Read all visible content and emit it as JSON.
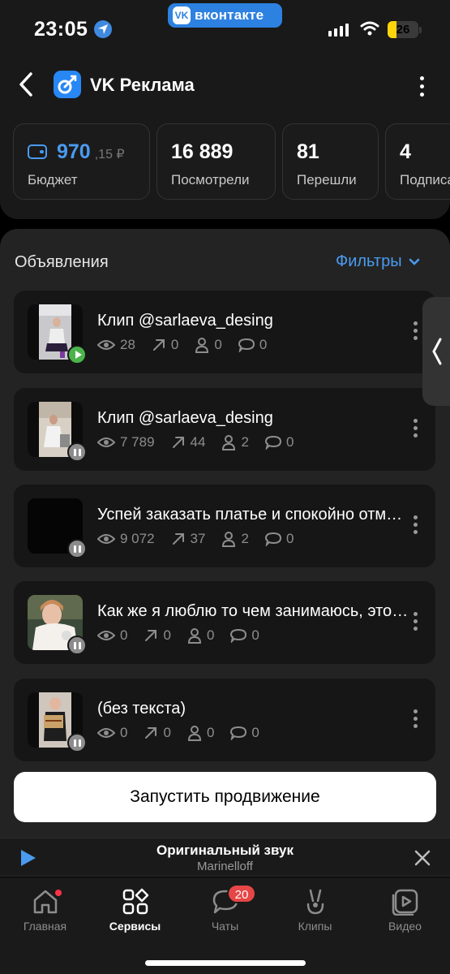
{
  "status_bar": {
    "time": "23:05",
    "app_pill": "вконтакте",
    "battery": "26"
  },
  "header": {
    "title": "VK Реклама"
  },
  "stats": [
    {
      "value": "970",
      "cents": ",15 ₽",
      "label": "Бюджет"
    },
    {
      "value": "16 889",
      "label": "Посмотрели"
    },
    {
      "value": "81",
      "label": "Перешли"
    },
    {
      "value": "4",
      "label": "Подписались"
    }
  ],
  "ads_section": {
    "title": "Объявления",
    "filters_label": "Фильтры"
  },
  "ads": [
    {
      "title": "Клип @sarlaeva_desing",
      "views": "28",
      "clicks": "0",
      "subs": "0",
      "comments": "0",
      "status": "playing"
    },
    {
      "title": "Клип @sarlaeva_desing",
      "views": "7 789",
      "clicks": "44",
      "subs": "2",
      "comments": "0",
      "status": "paused"
    },
    {
      "title": "Успей заказать платье и спокойно отмечать праздник",
      "views": "9 072",
      "clicks": "37",
      "subs": "2",
      "comments": "0",
      "status": "paused"
    },
    {
      "title": "Как же я люблю то чем занимаюсь, это просто прекрасно",
      "views": "0",
      "clicks": "0",
      "subs": "0",
      "comments": "0",
      "status": "paused"
    },
    {
      "title": "(без текста)",
      "views": "0",
      "clicks": "0",
      "subs": "0",
      "comments": "0",
      "status": "paused"
    }
  ],
  "launch_button": "Запустить продвижение",
  "player": {
    "title": "Оригинальный звук",
    "artist": "Marinelloff"
  },
  "tabs": [
    {
      "label": "Главная",
      "icon": "home-icon"
    },
    {
      "label": "Сервисы",
      "icon": "services-icon"
    },
    {
      "label": "Чаты",
      "icon": "chat-icon",
      "badge": "20"
    },
    {
      "label": "Клипы",
      "icon": "clips-icon"
    },
    {
      "label": "Видео",
      "icon": "video-icon"
    }
  ],
  "colors": {
    "accent": "#4a9bf0",
    "play_green": "#4bb34b",
    "badge_red": "#e64646",
    "background": "#232323"
  }
}
